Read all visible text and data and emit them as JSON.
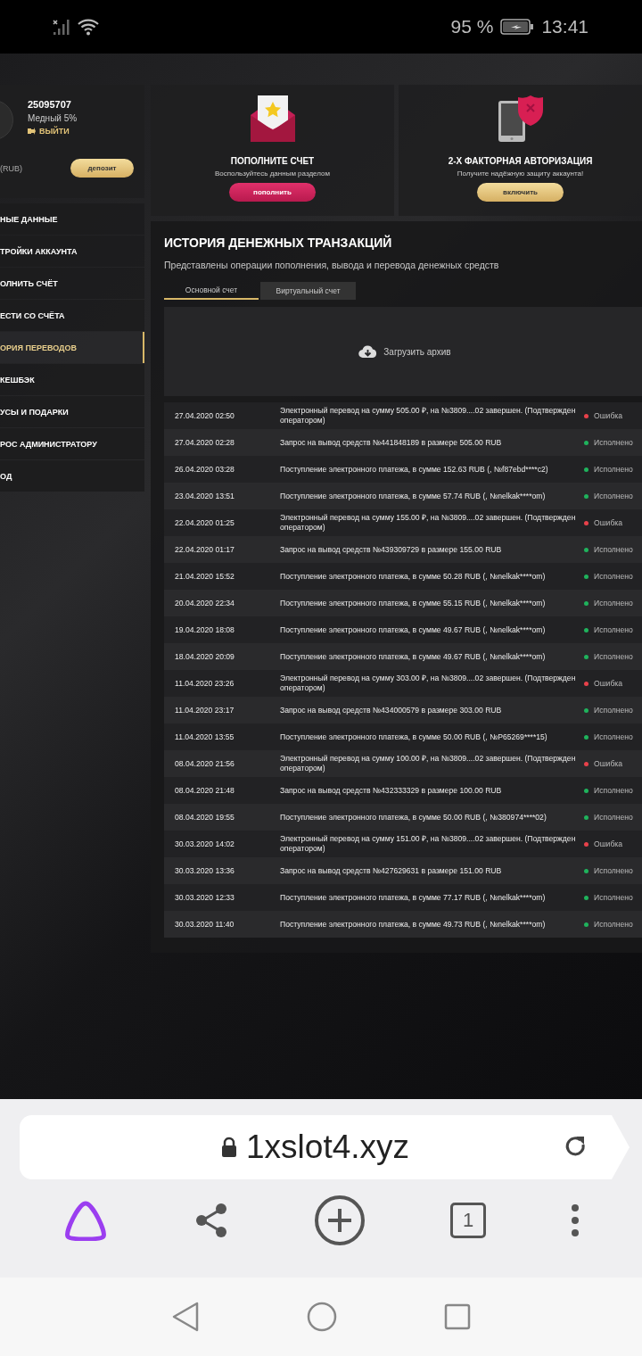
{
  "status_bar": {
    "battery": "95 %",
    "time": "13:41"
  },
  "profile": {
    "account_id": "25095707",
    "level": "Медный 5%",
    "logout": "ВЫЙТИ",
    "currency": "(RUB)",
    "deposit_button": "депозит"
  },
  "menu": [
    {
      "label": "НЫЕ ДАННЫЕ",
      "selected": false
    },
    {
      "label": "ТРОЙКИ АККАУНТА",
      "selected": false
    },
    {
      "label": "ОЛНИТЬ СЧЁТ",
      "selected": false
    },
    {
      "label": "ЕСТИ СО СЧЁТА",
      "selected": false
    },
    {
      "label": "ОРИЯ ПЕРЕВОДОВ",
      "selected": true
    },
    {
      "label": "КЕШБЭК",
      "selected": false
    },
    {
      "label": "УСЫ И ПОДАРКИ",
      "selected": false
    },
    {
      "label": "РОС АДМИНИСТРАТОРУ",
      "selected": false
    },
    {
      "label": "ОД",
      "selected": false
    }
  ],
  "promos": [
    {
      "kind": "deposit",
      "title": "ПОПОЛНИТЕ СЧЕТ",
      "subtitle": "Воспользуйтесь данным разделом",
      "button": "пополнить"
    },
    {
      "kind": "security",
      "title": "2-Х ФАКТОРНАЯ АВТОРИЗАЦИЯ",
      "subtitle": "Получите надёжную защиту аккаунта!",
      "button": "включить"
    }
  ],
  "history": {
    "title": "ИСТОРИЯ ДЕНЕЖНЫХ ТРАНЗАКЦИЙ",
    "subtitle": "Представлены операции пополнения, вывода и перевода денежных средств",
    "tabs": [
      {
        "label": "Основной счет",
        "selected": true
      },
      {
        "label": "Виртуальный счет",
        "selected": false
      }
    ],
    "download": "Загрузить архив",
    "rows": [
      {
        "date": "27.04.2020 02:50",
        "description": "Электронный перевод на сумму 505.00 ₽, на №3809....02 завершен. (Подтвержден оператором)",
        "status": "Ошибка",
        "color": "#e8414a"
      },
      {
        "date": "27.04.2020 02:28",
        "description": "Запрос на вывод средств №441848189 в размере 505.00 RUB",
        "status": "Исполнено",
        "color": "#1fb35c"
      },
      {
        "date": "26.04.2020 03:28",
        "description": "Поступление электронного платежа, в сумме 152.63 RUB (, №f87ebd****c2)",
        "status": "Исполнено",
        "color": "#1fb35c"
      },
      {
        "date": "23.04.2020 13:51",
        "description": "Поступление электронного платежа, в сумме 57.74 RUB (, №nelkak****om)",
        "status": "Исполнено",
        "color": "#1fb35c"
      },
      {
        "date": "22.04.2020 01:25",
        "description": "Электронный перевод на сумму 155.00 ₽, на №3809....02 завершен. (Подтвержден оператором)",
        "status": "Ошибка",
        "color": "#e8414a"
      },
      {
        "date": "22.04.2020 01:17",
        "description": "Запрос на вывод средств №439309729 в размере 155.00 RUB",
        "status": "Исполнено",
        "color": "#1fb35c"
      },
      {
        "date": "21.04.2020 15:52",
        "description": "Поступление электронного платежа, в сумме 50.28 RUB (, №nelkak****om)",
        "status": "Исполнено",
        "color": "#1fb35c"
      },
      {
        "date": "20.04.2020 22:34",
        "description": "Поступление электронного платежа, в сумме 55.15 RUB (, №nelkak****om)",
        "status": "Исполнено",
        "color": "#1fb35c"
      },
      {
        "date": "19.04.2020 18:08",
        "description": "Поступление электронного платежа, в сумме 49.67 RUB (, №nelkak****om)",
        "status": "Исполнено",
        "color": "#1fb35c"
      },
      {
        "date": "18.04.2020 20:09",
        "description": "Поступление электронного платежа, в сумме 49.67 RUB (, №nelkak****om)",
        "status": "Исполнено",
        "color": "#1fb35c"
      },
      {
        "date": "11.04.2020 23:26",
        "description": "Электронный перевод на сумму 303.00 ₽, на №3809....02 завершен. (Подтвержден оператором)",
        "status": "Ошибка",
        "color": "#e8414a"
      },
      {
        "date": "11.04.2020 23:17",
        "description": "Запрос на вывод средств №434000579 в размере 303.00 RUB",
        "status": "Исполнено",
        "color": "#1fb35c"
      },
      {
        "date": "11.04.2020 13:55",
        "description": "Поступление электронного платежа, в сумме 50.00 RUB (, №P65269****15)",
        "status": "Исполнено",
        "color": "#1fb35c"
      },
      {
        "date": "08.04.2020 21:56",
        "description": "Электронный перевод на сумму 100.00 ₽, на №3809....02 завершен. (Подтвержден оператором)",
        "status": "Ошибка",
        "color": "#e8414a"
      },
      {
        "date": "08.04.2020 21:48",
        "description": "Запрос на вывод средств №432333329 в размере 100.00 RUB",
        "status": "Исполнено",
        "color": "#1fb35c"
      },
      {
        "date": "08.04.2020 19:55",
        "description": "Поступление электронного платежа, в сумме 50.00 RUB (, №380974****02)",
        "status": "Исполнено",
        "color": "#1fb35c"
      },
      {
        "date": "30.03.2020 14:02",
        "description": "Электронный перевод на сумму 151.00 ₽, на №3809....02 завершен. (Подтвержден оператором)",
        "status": "Ошибка",
        "color": "#e8414a"
      },
      {
        "date": "30.03.2020 13:36",
        "description": "Запрос на вывод средств №427629631 в размере 151.00 RUB",
        "status": "Исполнено",
        "color": "#1fb35c"
      },
      {
        "date": "30.03.2020 12:33",
        "description": "Поступление электронного платежа, в сумме 77.17 RUB (, №nelkak****om)",
        "status": "Исполнено",
        "color": "#1fb35c"
      },
      {
        "date": "30.03.2020 11:40",
        "description": "Поступление электронного платежа, в сумме 49.73 RUB (, №nelkak****om)",
        "status": "Исполнено",
        "color": "#1fb35c"
      }
    ]
  },
  "browser": {
    "url": "1xslot4.xyz",
    "tab_count": "1"
  }
}
